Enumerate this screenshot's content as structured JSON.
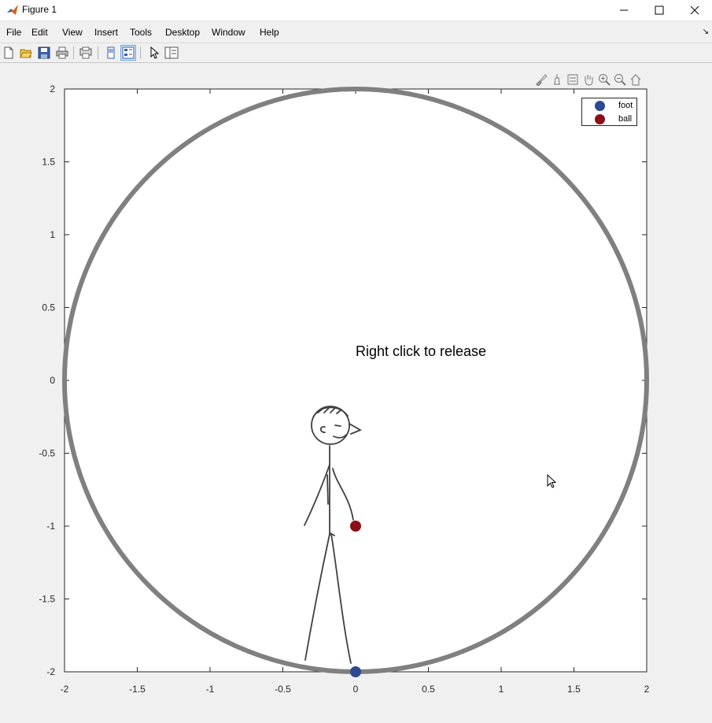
{
  "window": {
    "title": "Figure 1",
    "controls": [
      "minimize",
      "maximize",
      "close"
    ]
  },
  "menubar": {
    "items": [
      "File",
      "Edit",
      "View",
      "Insert",
      "Tools",
      "Desktop",
      "Window",
      "Help"
    ]
  },
  "toolbar": {
    "icons": [
      "new-figure-icon",
      "open-file-icon",
      "save-icon",
      "print-icon",
      "print-preview-icon",
      "link-plot-icon",
      "property-editor-icon",
      "pointer-icon",
      "plot-browser-icon"
    ],
    "active": "property-editor-icon"
  },
  "axes_toolbar": {
    "icons": [
      "brush-data-icon",
      "data-tips-icon",
      "rotate-legend-icon",
      "pan-icon",
      "zoom-in-icon",
      "zoom-out-icon",
      "home-icon"
    ]
  },
  "annotation": "Right click to release",
  "colors": {
    "foot": "#2b4a8f",
    "ball": "#8b0f14",
    "circle": "#808080",
    "figure_bg": "#f0f0f0"
  },
  "chart_data": {
    "type": "scatter",
    "xlim": [
      -2,
      2
    ],
    "ylim": [
      -2,
      2
    ],
    "xticks": [
      "-2",
      "-1.5",
      "-1",
      "-0.5",
      "0",
      "0.5",
      "1",
      "1.5",
      "2"
    ],
    "yticks": [
      "2",
      "1.5",
      "1",
      "0.5",
      "0",
      "-0.5",
      "-1",
      "-1.5",
      "-2"
    ],
    "circle": {
      "cx": 0,
      "cy": 0,
      "r": 2
    },
    "series": [
      {
        "name": "foot",
        "x": [
          0
        ],
        "y": [
          -2
        ]
      },
      {
        "name": "ball",
        "x": [
          0
        ],
        "y": [
          -1
        ]
      }
    ],
    "legend_position": "top-right",
    "grid": false
  }
}
